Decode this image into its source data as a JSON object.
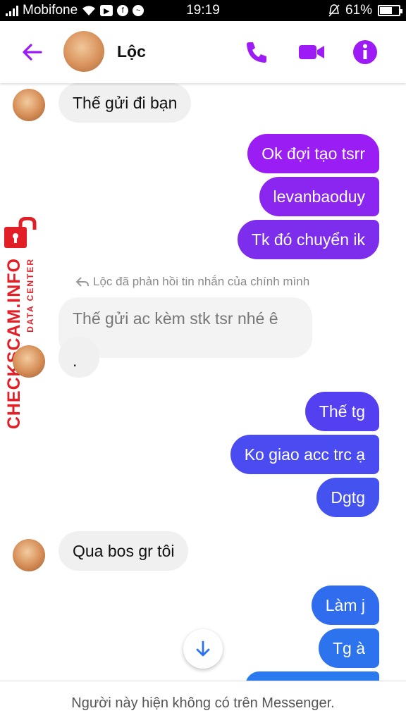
{
  "status": {
    "carrier": "Mobifone",
    "time": "19:19",
    "battery": "61%"
  },
  "header": {
    "name": "Lộc"
  },
  "messages": {
    "m1": "Thế gửi đi bạn",
    "m2": "Ok đợi tạo tsrr",
    "m3": "levanbaoduy",
    "m4": "Tk đó chuyển ik",
    "reply_note": "Lộc đã phản hồi tin nhắn của chính mình",
    "m5": "Thế gửi ac kèm stk tsr nhé ê",
    "m6": ".",
    "m7": "Thế tg",
    "m8": "Ko giao acc trc ạ",
    "m9": "Dgtg",
    "m10": "Qua bos gr tôi",
    "m11": "Làm j",
    "m12": "Tg à"
  },
  "watermark": {
    "brand": "CHECKSCAM.INFO",
    "sub": "DATA CENTER"
  },
  "footer": {
    "notice": "Người này hiện không có trên Messenger."
  },
  "colors": {
    "accent": "#9d1cf5",
    "purple_bubble": "#8f22f0",
    "indigo_bubble": "#5046f2",
    "blue_bubble": "#2d73ee"
  },
  "icons": [
    "back-arrow-icon",
    "phone-icon",
    "video-camera-icon",
    "info-icon",
    "scroll-down-icon",
    "reply-icon",
    "lock-icon"
  ]
}
